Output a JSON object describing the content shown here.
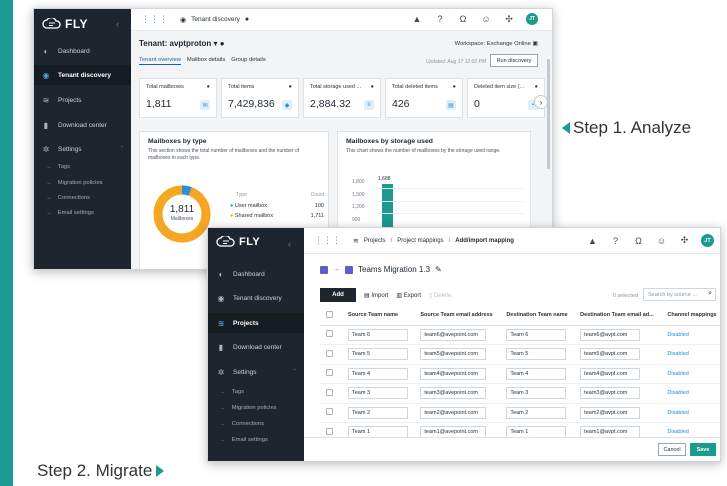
{
  "colors": {
    "accent": "#1b9a90",
    "sidebar": "#1d262f",
    "link": "#1b8fd6",
    "donut_main": "#f5a623",
    "donut_other": "#2b8fd6",
    "bar": "#1b9a90"
  },
  "discovery": {
    "logo": "FLY",
    "nav": [
      {
        "label": "Dashboard",
        "icon": "dashboard-icon"
      },
      {
        "label": "Tenant discovery",
        "icon": "discovery-icon",
        "active": true
      },
      {
        "label": "Projects",
        "icon": "projects-icon"
      },
      {
        "label": "Download center",
        "icon": "download-icon"
      },
      {
        "label": "Settings",
        "icon": "settings-icon"
      }
    ],
    "settings_sub": [
      "Tags",
      "Migration policies",
      "Connections",
      "Email settings"
    ],
    "breadcrumb": "Tenant discovery",
    "tenant_title": "Tenant: avptproton",
    "workspace": "Workspace: Exchange Online",
    "tabs": [
      "Tenant overview",
      "Mailbox details",
      "Group details"
    ],
    "updated": "Updated: Aug 17 12:02 PM",
    "run_button": "Run discovery",
    "cards": [
      {
        "label": "Total mailboxes",
        "value": "1,811"
      },
      {
        "label": "Total items",
        "value": "7,429,836"
      },
      {
        "label": "Total storage used ...",
        "value": "2,884.32"
      },
      {
        "label": "Total deleted items",
        "value": "426"
      },
      {
        "label": "Deleted item size (...",
        "value": "0"
      }
    ],
    "panel_type": {
      "title": "Mailboxes by type",
      "desc": "This section shows the total number of mailboxes and the number of mailboxes in each type.",
      "donut_value": "1,811",
      "donut_label": "Mailboxes",
      "col_type": "Type",
      "col_count": "Count",
      "rows": [
        {
          "type": "User mailbox",
          "count": "100"
        },
        {
          "type": "Shared mailbox",
          "count": "1,711"
        }
      ]
    },
    "panel_storage": {
      "title": "Mailboxes by storage used",
      "desc": "This chart shows the number of mailboxes by the storage used range.",
      "yticks": [
        "1,800",
        "1,500",
        "1,200",
        "900"
      ],
      "bar_label": "1,688"
    },
    "user": {
      "initials": "JT"
    }
  },
  "migration": {
    "logo": "FLY",
    "nav": [
      {
        "label": "Dashboard",
        "icon": "dashboard-icon"
      },
      {
        "label": "Tenant discovery",
        "icon": "discovery-icon"
      },
      {
        "label": "Projects",
        "icon": "projects-icon",
        "active": true
      },
      {
        "label": "Download center",
        "icon": "download-icon"
      },
      {
        "label": "Settings",
        "icon": "settings-icon"
      }
    ],
    "settings_sub": [
      "Tags",
      "Migration policies",
      "Connections",
      "Email settings"
    ],
    "breadcrumb": {
      "projects": "Projects",
      "mappings": "Project mappings",
      "current": "Add/import mapping"
    },
    "title": "Teams Migration 1.3",
    "toolbar": {
      "add": "Add",
      "import": "Import",
      "export": "Export",
      "delete": "Delete"
    },
    "selected": "0 selected",
    "search_placeholder": "Search by source ...",
    "columns": [
      "Source Team name",
      "Source Team email address",
      "Destination Team name",
      "Destination Team email ad...",
      "Channel mappings"
    ],
    "rows": [
      {
        "src": "Team 6",
        "src_email": "team6@avepoint.com",
        "dst": "Team 6",
        "dst_email": "team6@avpt.com",
        "status": "Disabled"
      },
      {
        "src": "Team 5",
        "src_email": "team5@avepoint.com",
        "dst": "Team 5",
        "dst_email": "team5@avpt.com",
        "status": "Disabled"
      },
      {
        "src": "Team 4",
        "src_email": "team4@avepoint.com",
        "dst": "Team 4",
        "dst_email": "team4@avpt.com",
        "status": "Disabled"
      },
      {
        "src": "Team 3",
        "src_email": "team3@avepoint.com",
        "dst": "Team 3",
        "dst_email": "team3@avpt.com",
        "status": "Disabled"
      },
      {
        "src": "Team 2",
        "src_email": "team2@avepoint.com",
        "dst": "Team 2",
        "dst_email": "team2@avpt.com",
        "status": "Disabled"
      },
      {
        "src": "Team 1",
        "src_email": "team1@avepoint.com",
        "dst": "Team 1",
        "dst_email": "team1@avpt.com",
        "status": "Disabled"
      }
    ],
    "cancel": "Cancel",
    "save": "Save",
    "user": {
      "initials": "JT"
    }
  },
  "steps": {
    "step1": "Step 1. Analyze",
    "step2": "Step 2. Migrate"
  }
}
